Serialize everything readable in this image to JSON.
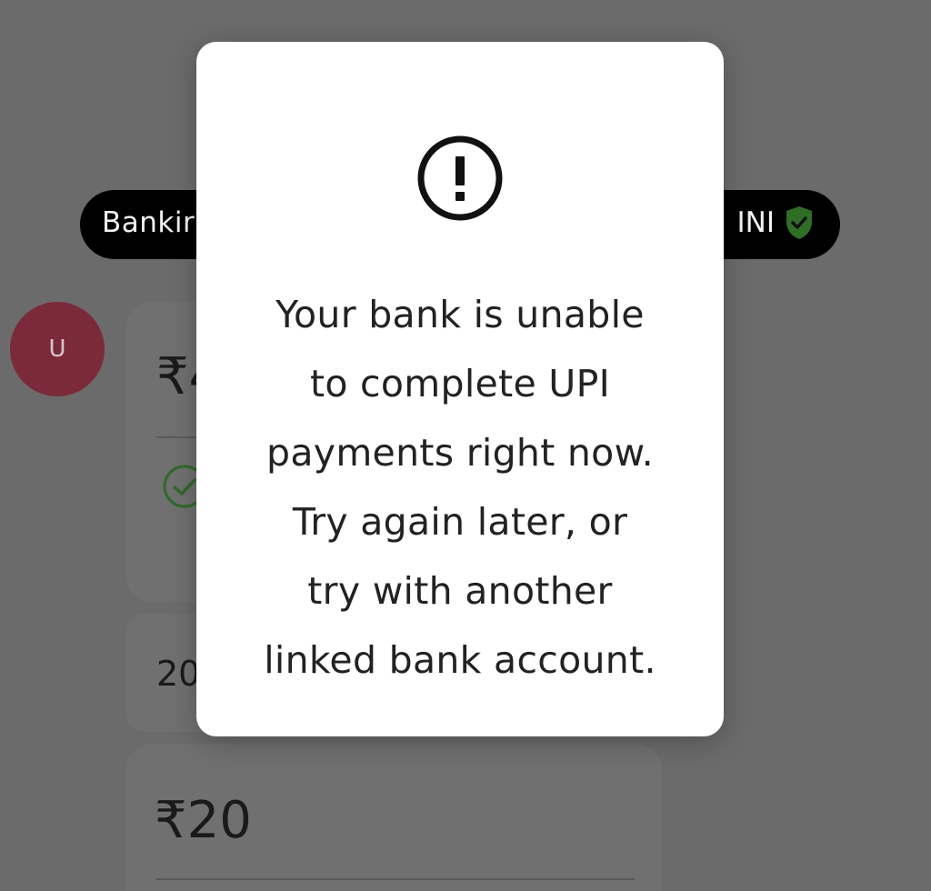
{
  "background": {
    "banking_pill": {
      "left_label": "Bankir",
      "right_label": "INI",
      "shield_icon": "shield-check-icon",
      "shield_color": "#3a8a2e"
    },
    "avatar": {
      "initial": "U",
      "color": "#7b2a3a"
    },
    "cards": [
      {
        "amount": "₹4"
      },
      {
        "date": "20"
      },
      {
        "amount": "₹20"
      }
    ],
    "check_icon": "check-circle-icon",
    "check_color": "#2f7d2a"
  },
  "dialog": {
    "icon": "exclamation-circle-icon",
    "message_lines": [
      "Your bank is unable",
      "to complete UPI",
      "payments right now.",
      "Try again later, or",
      "try with another",
      "linked bank account."
    ]
  }
}
